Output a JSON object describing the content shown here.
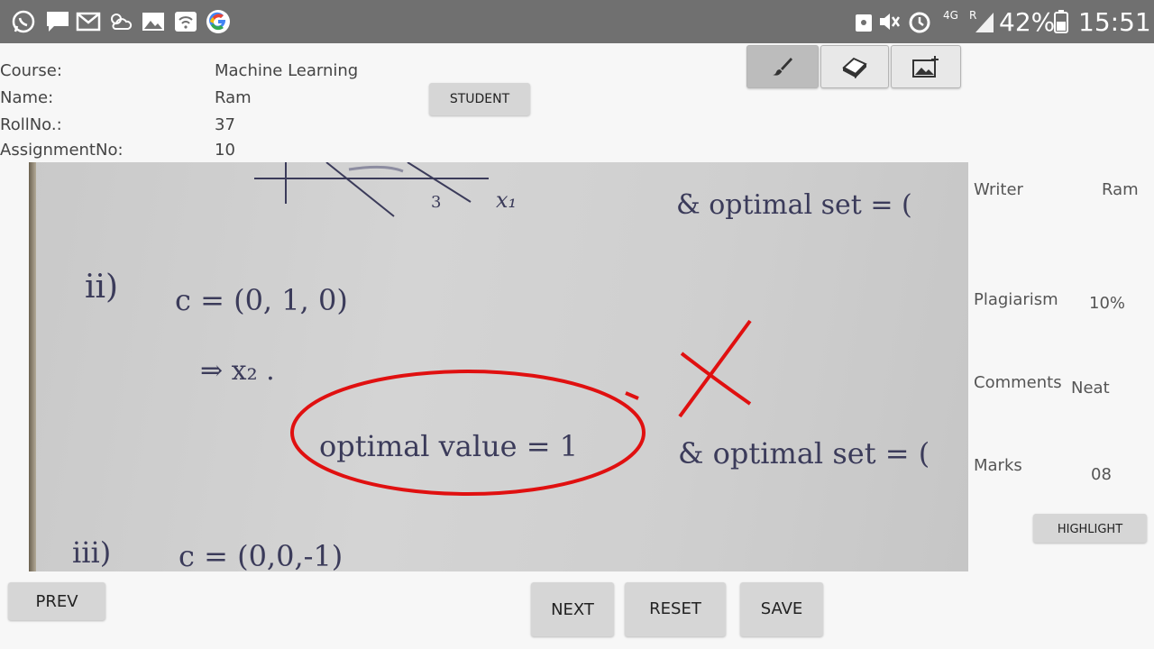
{
  "status_bar": {
    "battery": "42%",
    "time": "15:51",
    "network": "4G",
    "roaming": "R"
  },
  "info": {
    "course_label": "Course:",
    "course_value": "Machine Learning",
    "name_label": "Name:",
    "name_value": "Ram",
    "roll_label": "RollNo.:",
    "roll_value": "37",
    "assignment_label": "AssignmentNo:",
    "assignment_value": "10"
  },
  "buttons": {
    "student": "STUDENT",
    "highlight": "HIGHLIGHT",
    "prev": "PREV",
    "next": "NEXT",
    "reset": "RESET",
    "save": "SAVE"
  },
  "toolbar": {
    "icons": [
      "brush-icon",
      "eraser-icon",
      "add-image-icon"
    ],
    "active": "brush-icon"
  },
  "sidebar": {
    "writer_label": "Writer",
    "writer_value": "Ram",
    "plagiarism_label": "Plagiarism",
    "plagiarism_value": "10%",
    "comments_label": "Comments",
    "comments_value": "Neat",
    "marks_label": "Marks",
    "marks_value": "08"
  },
  "sheet": {
    "line1_right": "& optimal set = (",
    "item2_number": "ii)",
    "item2_c": "c =  (0, 1, 0)",
    "arrow_line": "⇒  x₂ .",
    "optimal_value": "optimal  value =   1",
    "optimal_set": "&  optimal  set = (",
    "item3_number": "iii)",
    "item3_c": "c =  (0,0,-1)"
  },
  "colors": {
    "annotation": "#e01010",
    "status_bar": "#707070",
    "button": "#d6d6d6"
  }
}
